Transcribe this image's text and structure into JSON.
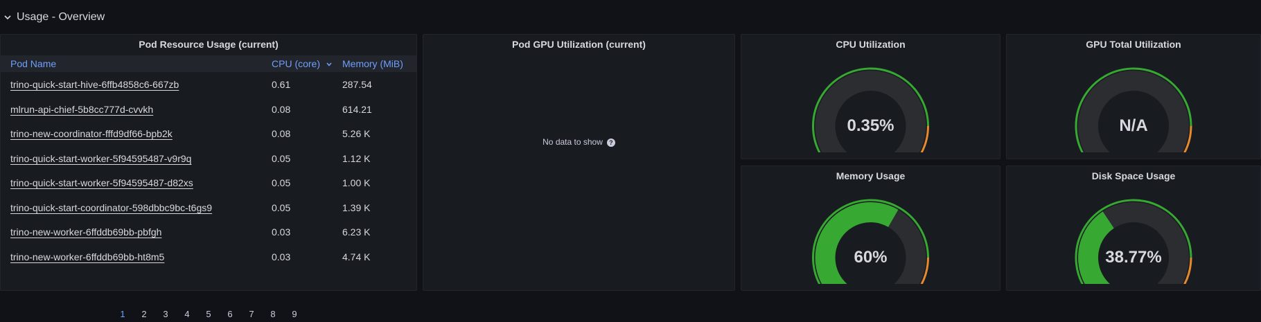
{
  "row": {
    "title": "Usage - Overview"
  },
  "table_panel": {
    "title": "Pod Resource Usage (current)",
    "columns": {
      "pod": "Pod Name",
      "cpu": "CPU (core)",
      "mem": "Memory (MiB)"
    },
    "rows": [
      {
        "pod": "trino-quick-start-hive-6ffb4858c6-667zb",
        "cpu": "0.61",
        "mem": "287.54"
      },
      {
        "pod": "mlrun-api-chief-5b8cc777d-cvvkh",
        "cpu": "0.08",
        "mem": "614.21"
      },
      {
        "pod": "trino-new-coordinator-fffd9df66-bpb2k",
        "cpu": "0.08",
        "mem": "5.26 K"
      },
      {
        "pod": "trino-quick-start-worker-5f94595487-v9r9q",
        "cpu": "0.05",
        "mem": "1.12 K"
      },
      {
        "pod": "trino-quick-start-worker-5f94595487-d82xs",
        "cpu": "0.05",
        "mem": "1.00 K"
      },
      {
        "pod": "trino-quick-start-coordinator-598dbbc9bc-t6gs9",
        "cpu": "0.05",
        "mem": "1.39 K"
      },
      {
        "pod": "trino-new-worker-6ffddb69bb-pbfgh",
        "cpu": "0.03",
        "mem": "6.23 K"
      },
      {
        "pod": "trino-new-worker-6ffddb69bb-ht8m5",
        "cpu": "0.03",
        "mem": "4.74 K"
      }
    ],
    "pages": [
      "1",
      "2",
      "3",
      "4",
      "5",
      "6",
      "7",
      "8",
      "9"
    ],
    "active_page": "1"
  },
  "gpu_panel": {
    "title": "Pod GPU Utilization (current)",
    "message": "No data to show"
  },
  "gauges": {
    "cpu": {
      "title": "CPU Utilization",
      "value_text": "0.35%",
      "fraction": 0.0035
    },
    "gpu": {
      "title": "GPU Total Utilization",
      "value_text": "N/A",
      "fraction": 0
    },
    "mem": {
      "title": "Memory Usage",
      "value_text": "60%",
      "fraction": 0.6
    },
    "disk": {
      "title": "Disk Space Usage",
      "value_text": "38.77%",
      "fraction": 0.3877
    }
  },
  "colors": {
    "green": "#37a832",
    "orange": "#e68a2e",
    "red": "#e02f44",
    "track": "#2c2d31",
    "link": "#6e9fff"
  }
}
